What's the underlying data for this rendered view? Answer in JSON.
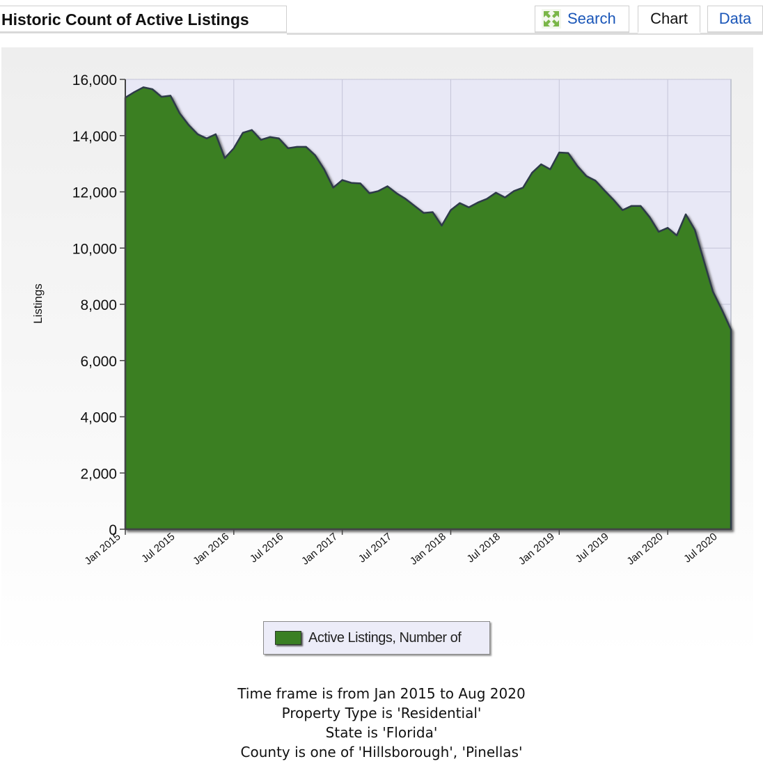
{
  "header": {
    "title": "Historic Count of Active Listings",
    "tabs": {
      "search": "Search",
      "chart": "Chart",
      "data": "Data"
    }
  },
  "legend": {
    "label": "Active Listings, Number of"
  },
  "footer": {
    "lines": [
      "Time frame is from Jan 2015 to Aug 2020",
      "Property Type is 'Residential'",
      "State is 'Florida'",
      "County is one of 'Hillsborough', 'Pinellas'"
    ]
  },
  "colors": {
    "fill": "#3a7f24",
    "plot_background": "#e8e8f6",
    "link": "#1a56b8"
  },
  "chart_data": {
    "type": "area",
    "xlabel": "",
    "ylabel": "Listings",
    "ylim": [
      0,
      16000
    ],
    "yticks": [
      0,
      2000,
      4000,
      6000,
      8000,
      10000,
      12000,
      14000,
      16000
    ],
    "xtick_labels": [
      "Jan 2015",
      "Jul 2015",
      "Jan 2016",
      "Jul 2016",
      "Jan 2017",
      "Jul 2017",
      "Jan 2018",
      "Jul 2018",
      "Jan 2019",
      "Jul 2019",
      "Jan 2020",
      "Jul 2020"
    ],
    "grid": true,
    "legend_position": "bottom",
    "series": [
      {
        "name": "Active Listings, Number of",
        "x": [
          "Jan 2015",
          "Feb 2015",
          "Mar 2015",
          "Apr 2015",
          "May 2015",
          "Jun 2015",
          "Jul 2015",
          "Aug 2015",
          "Sep 2015",
          "Oct 2015",
          "Nov 2015",
          "Dec 2015",
          "Jan 2016",
          "Feb 2016",
          "Mar 2016",
          "Apr 2016",
          "May 2016",
          "Jun 2016",
          "Jul 2016",
          "Aug 2016",
          "Sep 2016",
          "Oct 2016",
          "Nov 2016",
          "Dec 2016",
          "Jan 2017",
          "Feb 2017",
          "Mar 2017",
          "Apr 2017",
          "May 2017",
          "Jun 2017",
          "Jul 2017",
          "Aug 2017",
          "Sep 2017",
          "Oct 2017",
          "Nov 2017",
          "Dec 2017",
          "Jan 2018",
          "Feb 2018",
          "Mar 2018",
          "Apr 2018",
          "May 2018",
          "Jun 2018",
          "Jul 2018",
          "Aug 2018",
          "Sep 2018",
          "Oct 2018",
          "Nov 2018",
          "Dec 2018",
          "Jan 2019",
          "Feb 2019",
          "Mar 2019",
          "Apr 2019",
          "May 2019",
          "Jun 2019",
          "Jul 2019",
          "Aug 2019",
          "Sep 2019",
          "Oct 2019",
          "Nov 2019",
          "Dec 2019",
          "Jan 2020",
          "Feb 2020",
          "Mar 2020",
          "Apr 2020",
          "May 2020",
          "Jun 2020",
          "Jul 2020",
          "Aug 2020"
        ],
        "values": [
          15350,
          15550,
          15720,
          15650,
          15380,
          15420,
          14800,
          14380,
          14050,
          13900,
          14050,
          13200,
          13550,
          14100,
          14200,
          13850,
          13950,
          13900,
          13550,
          13600,
          13600,
          13300,
          12800,
          12150,
          12420,
          12320,
          12300,
          11950,
          12030,
          12200,
          11950,
          11750,
          11500,
          11250,
          11280,
          10800,
          11350,
          11600,
          11450,
          11620,
          11750,
          11970,
          11800,
          12030,
          12150,
          12680,
          12980,
          12800,
          13400,
          13380,
          12920,
          12560,
          12400,
          12050,
          11720,
          11350,
          11500,
          11500,
          11100,
          10580,
          10720,
          10450,
          11200,
          10650,
          9550,
          8450,
          7800,
          7100
        ]
      }
    ]
  }
}
